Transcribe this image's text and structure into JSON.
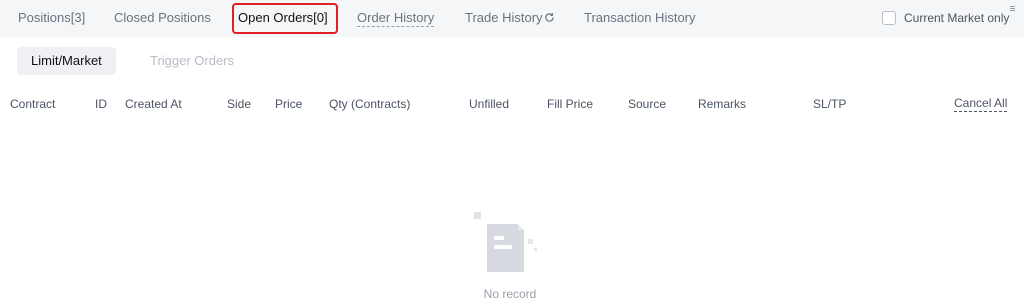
{
  "tabs": [
    {
      "label": "Positions[3]"
    },
    {
      "label": "Closed Positions"
    },
    {
      "label": "Open Orders[0]"
    },
    {
      "label": "Order History"
    },
    {
      "label": "Trade History"
    },
    {
      "label": "Transaction History"
    }
  ],
  "filter": {
    "current_market_label": "Current Market only",
    "checked": false
  },
  "subtabs": [
    {
      "label": "Limit/Market"
    },
    {
      "label": "Trigger Orders"
    }
  ],
  "table": {
    "columns": [
      "Contract",
      "ID",
      "Created At",
      "Side",
      "Price",
      "Qty (Contracts)",
      "Unfilled",
      "Fill Price",
      "Source",
      "Remarks",
      "SL/TP"
    ],
    "cancel_all_label": "Cancel All"
  },
  "empty_state": {
    "text": "No record"
  },
  "colors": {
    "highlight": "#e02020",
    "active_text": "#111111",
    "muted_text": "#6b7280"
  }
}
